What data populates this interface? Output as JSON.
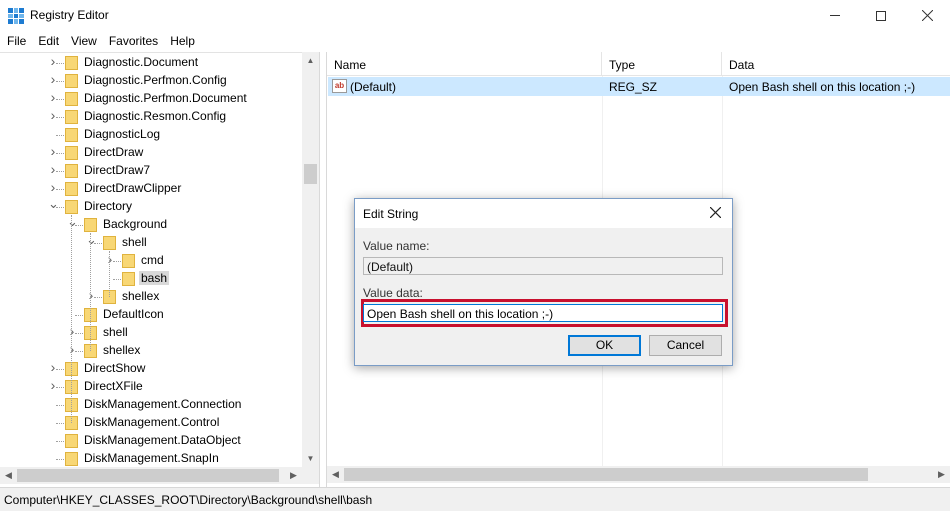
{
  "window": {
    "title": "Registry Editor"
  },
  "menu": [
    "File",
    "Edit",
    "View",
    "Favorites",
    "Help"
  ],
  "tree": {
    "items": [
      {
        "label": "Diagnostic.Document",
        "level": 0,
        "expander": "collapsed"
      },
      {
        "label": "Diagnostic.Perfmon.Config",
        "level": 0,
        "expander": "collapsed"
      },
      {
        "label": "Diagnostic.Perfmon.Document",
        "level": 0,
        "expander": "collapsed"
      },
      {
        "label": "Diagnostic.Resmon.Config",
        "level": 0,
        "expander": "collapsed"
      },
      {
        "label": "DiagnosticLog",
        "level": 0,
        "expander": "none"
      },
      {
        "label": "DirectDraw",
        "level": 0,
        "expander": "collapsed"
      },
      {
        "label": "DirectDraw7",
        "level": 0,
        "expander": "collapsed"
      },
      {
        "label": "DirectDrawClipper",
        "level": 0,
        "expander": "collapsed"
      },
      {
        "label": "Directory",
        "level": 0,
        "expander": "expanded"
      },
      {
        "label": "Background",
        "level": 1,
        "expander": "expanded"
      },
      {
        "label": "shell",
        "level": 2,
        "expander": "expanded"
      },
      {
        "label": "cmd",
        "level": 3,
        "expander": "collapsed"
      },
      {
        "label": "bash",
        "level": 3,
        "expander": "none",
        "selected": true
      },
      {
        "label": "shellex",
        "level": 2,
        "expander": "collapsed"
      },
      {
        "label": "DefaultIcon",
        "level": 1,
        "expander": "none"
      },
      {
        "label": "shell",
        "level": 1,
        "expander": "collapsed"
      },
      {
        "label": "shellex",
        "level": 1,
        "expander": "collapsed"
      },
      {
        "label": "DirectShow",
        "level": 0,
        "expander": "collapsed"
      },
      {
        "label": "DirectXFile",
        "level": 0,
        "expander": "collapsed"
      },
      {
        "label": "DiskManagement.Connection",
        "level": 0,
        "expander": "none"
      },
      {
        "label": "DiskManagement.Control",
        "level": 0,
        "expander": "none"
      },
      {
        "label": "DiskManagement.DataObject",
        "level": 0,
        "expander": "none"
      },
      {
        "label": "DiskManagement.SnapIn",
        "level": 0,
        "expander": "none"
      }
    ]
  },
  "list": {
    "columns": [
      "Name",
      "Type",
      "Data"
    ],
    "rows": [
      {
        "name": "(Default)",
        "type": "REG_SZ",
        "data": "Open Bash shell on this location ;-)",
        "icon": "ab-string-icon",
        "selected": true
      }
    ]
  },
  "status": {
    "path": "Computer\\HKEY_CLASSES_ROOT\\Directory\\Background\\shell\\bash"
  },
  "dialog": {
    "title": "Edit String",
    "value_name_label": "Value name:",
    "value_name": "(Default)",
    "value_data_label": "Value data:",
    "value_data": "Open Bash shell on this location ;-)",
    "ok_label": "OK",
    "cancel_label": "Cancel",
    "highlight_color": "#c8102e"
  },
  "colors": {
    "selection": "#cce8ff",
    "folder": "#f8d775",
    "accent": "#0078d7"
  }
}
